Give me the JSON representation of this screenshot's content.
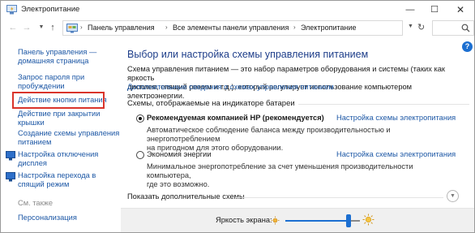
{
  "window": {
    "title": "Электропитание",
    "controls": {
      "minimize": "—",
      "maximize": "☐",
      "close": "✕"
    }
  },
  "nav": {
    "breadcrumbs": [
      "Панель управления",
      "Все элементы панели управления",
      "Электропитание"
    ],
    "icons": [
      "back-arrow-icon",
      "forward-arrow-icon",
      "up-arrow-icon",
      "refresh-icon",
      "search-icon"
    ]
  },
  "sidebar": {
    "home_line1": "Панель управления —",
    "home_line2": "домашняя страница",
    "items": [
      {
        "line1": "Запрос пароля при",
        "line2": "пробуждении",
        "icon": ""
      },
      {
        "line1": "Действие кнопки питания",
        "line2": "",
        "icon": ""
      },
      {
        "line1": "Действие при закрытии",
        "line2": "крышки",
        "icon": ""
      },
      {
        "line1": "Создание схемы управления",
        "line2": "питанием",
        "icon": ""
      },
      {
        "line1": "Настройка отключения",
        "line2": "дисплея",
        "icon": "monitor-icon"
      },
      {
        "line1": "Настройка перехода в",
        "line2": "спящий режим",
        "icon": "monitor-icon"
      }
    ],
    "see_also": "См. также",
    "personalization": "Персонализация",
    "highlight_color": "#d9342b"
  },
  "main": {
    "title": "Выбор или настройка схемы управления питанием",
    "desc_line1": "Схема управления питанием — это набор параметров оборудования и системы (таких как яркость",
    "desc_line2": "дисплея, спящий режим и т.д.), который регулирует использование компьютером электроэнергии.",
    "more_link": "Дополнительные сведения о схемах управления питанием",
    "group_label": "Схемы, отображаемые на индикаторе батареи",
    "plans": [
      {
        "name": "Рекомендуемая компанией HP (рекомендуется)",
        "selected": true,
        "settings": "Настройка схемы электропитания",
        "desc_line1": "Автоматическое соблюдение баланса между производительностью и энергопотреблением",
        "desc_line2": "на пригодном для этого оборудовании."
      },
      {
        "name": "Экономия энергии",
        "selected": false,
        "settings": "Настройка схемы электропитания",
        "desc_line1": "Минимальное энергопотребление за счет уменьшения производительности компьютера,",
        "desc_line2": "где это возможно."
      }
    ],
    "more_plans": "Показать дополнительные схемы"
  },
  "brightness": {
    "label": "Яркость экрана:",
    "level_percent": 85
  },
  "colors": {
    "link": "#1c57a5",
    "title": "#1e3e8a",
    "accent": "#1c6fd1"
  }
}
